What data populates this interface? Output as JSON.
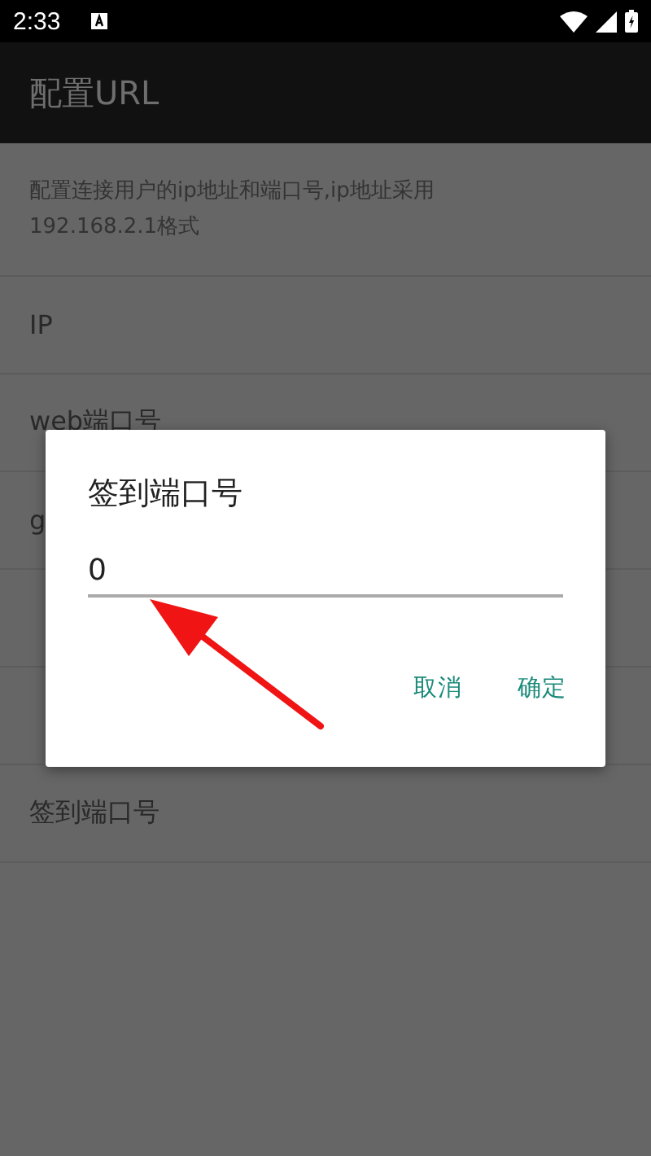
{
  "status_bar": {
    "time": "2:33"
  },
  "app_bar": {
    "title": "配置URL"
  },
  "list": [
    {
      "kind": "summary",
      "text": "配置连接用户的ip地址和端口号,ip地址采用192.168.2.1格式"
    },
    {
      "kind": "item",
      "text": "IP"
    },
    {
      "kind": "item",
      "text": "web端口号"
    },
    {
      "kind": "item",
      "text": "g"
    },
    {
      "kind": "summary"
    },
    {
      "kind": "item"
    },
    {
      "kind": "item",
      "text": "签到端口号"
    }
  ],
  "dialog": {
    "title": "签到端口号",
    "value": "0",
    "buttons": [
      "取消",
      "确定"
    ]
  }
}
